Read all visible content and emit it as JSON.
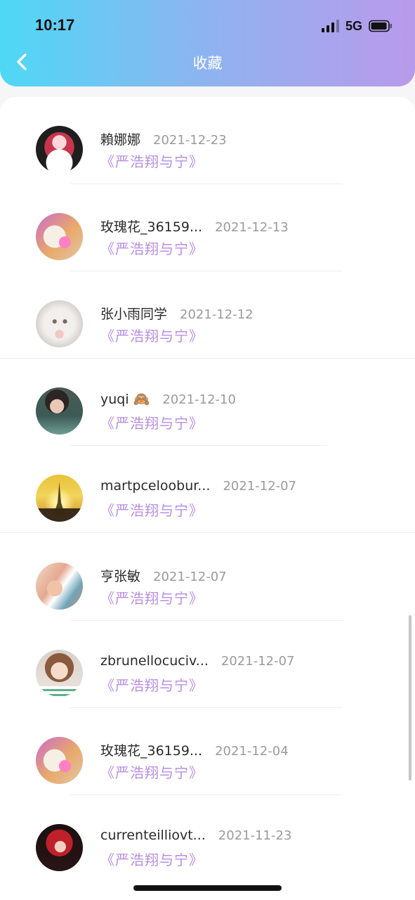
{
  "status_bar": {
    "time": "10:17",
    "network": "5G",
    "icons": [
      "cellular-signal-icon",
      "battery-icon"
    ]
  },
  "nav": {
    "title": "收藏",
    "back_icon": "chevron-left-icon"
  },
  "colors": {
    "header_gradient": [
      "#4ed8f6",
      "#b99aeb"
    ],
    "book_title": "#b98ee3",
    "date": "#9b9b9b"
  },
  "favorites": [
    {
      "username": "賴娜娜",
      "date": "2021-12-23",
      "book": "《严浩翔与宁》"
    },
    {
      "username": "玫瑰花_36159...",
      "date": "2021-12-13",
      "book": "《严浩翔与宁》"
    },
    {
      "username": "张小雨同学",
      "date": "2021-12-12",
      "book": "《严浩翔与宁》"
    },
    {
      "username": "yuqi 🙈",
      "date": "2021-12-10",
      "book": "《严浩翔与宁》"
    },
    {
      "username": "martpceloobur...",
      "date": "2021-12-07",
      "book": "《严浩翔与宁》"
    },
    {
      "username": "亨张敏",
      "date": "2021-12-07",
      "book": "《严浩翔与宁》"
    },
    {
      "username": "zbrunellocuciv...",
      "date": "2021-12-07",
      "book": "《严浩翔与宁》"
    },
    {
      "username": "玫瑰花_36159...",
      "date": "2021-12-04",
      "book": "《严浩翔与宁》"
    },
    {
      "username": "currenteilliovt...",
      "date": "2021-11-23",
      "book": "《严浩翔与宁》"
    }
  ]
}
